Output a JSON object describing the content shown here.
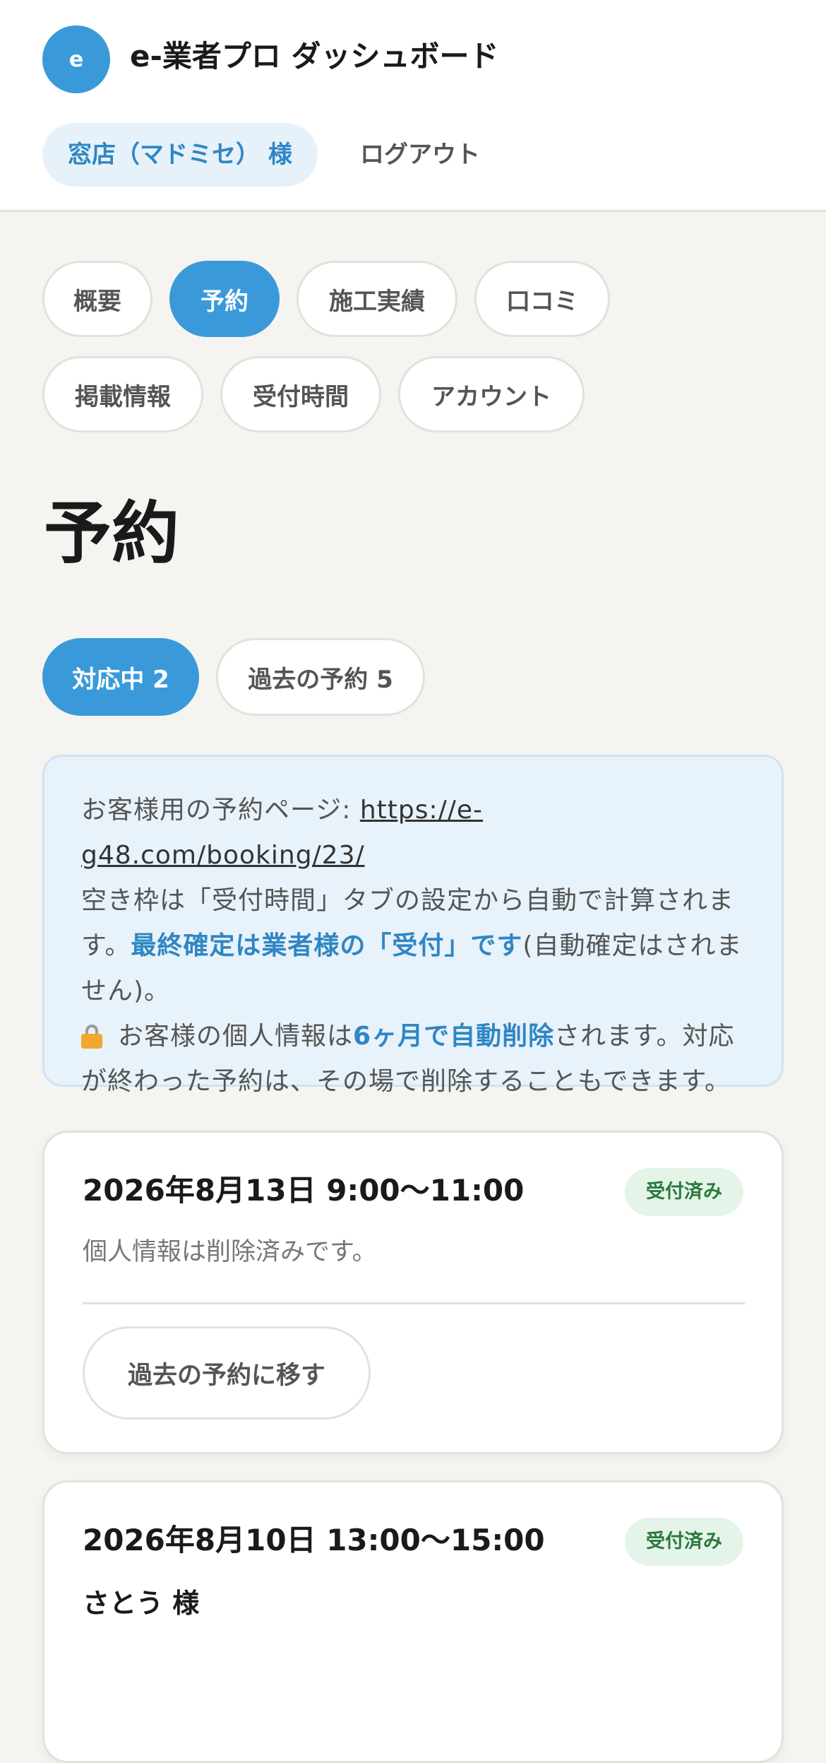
{
  "header": {
    "logo_letter": "e",
    "app_title": "e-業者プロ ダッシュボード",
    "user_label": "窓店（マドミセ） 様",
    "logout_label": "ログアウト"
  },
  "nav_tabs": [
    {
      "label": "概要",
      "active": false
    },
    {
      "label": "予約",
      "active": true
    },
    {
      "label": "施工実績",
      "active": false
    },
    {
      "label": "口コミ",
      "active": false
    },
    {
      "label": "掲載情報",
      "active": false
    },
    {
      "label": "受付時間",
      "active": false
    },
    {
      "label": "アカウント",
      "active": false
    }
  ],
  "page_title": "予約",
  "segments": [
    {
      "label": "対応中 2",
      "active": true
    },
    {
      "label": "過去の予約 5",
      "active": false
    }
  ],
  "info": {
    "booking_page_label": "お客様用の予約ページ: ",
    "booking_url": "https://e-g48.com/booking/23/",
    "slots_text": "空き枠は「受付時間」タブの設定から自動で計算されます。",
    "final_confirm_strong": "最終確定は業者様の「受付」です",
    "final_confirm_rest": "(自動確定はされません)。",
    "privacy_prefix": "お客様の個人情報は",
    "privacy_strong": "6ヶ月で自動削除",
    "privacy_rest": "されます。対応が終わった予約は、その場で削除することもできます。",
    "lock_icon": "lock-icon"
  },
  "bookings": [
    {
      "datetime": "2026年8月13日 9:00〜11:00",
      "status": "受付済み",
      "note": "個人情報は削除済みです。",
      "action_label": "過去の予約に移す"
    },
    {
      "datetime": "2026年8月10日 13:00〜15:00",
      "status": "受付済み",
      "customer": "さとう 様"
    }
  ],
  "colors": {
    "accent": "#3a9ad9",
    "background": "#f5f4f0",
    "info_bg": "#e8f2fa",
    "badge_bg": "#e5f4e9",
    "badge_text": "#2a7a3e"
  }
}
